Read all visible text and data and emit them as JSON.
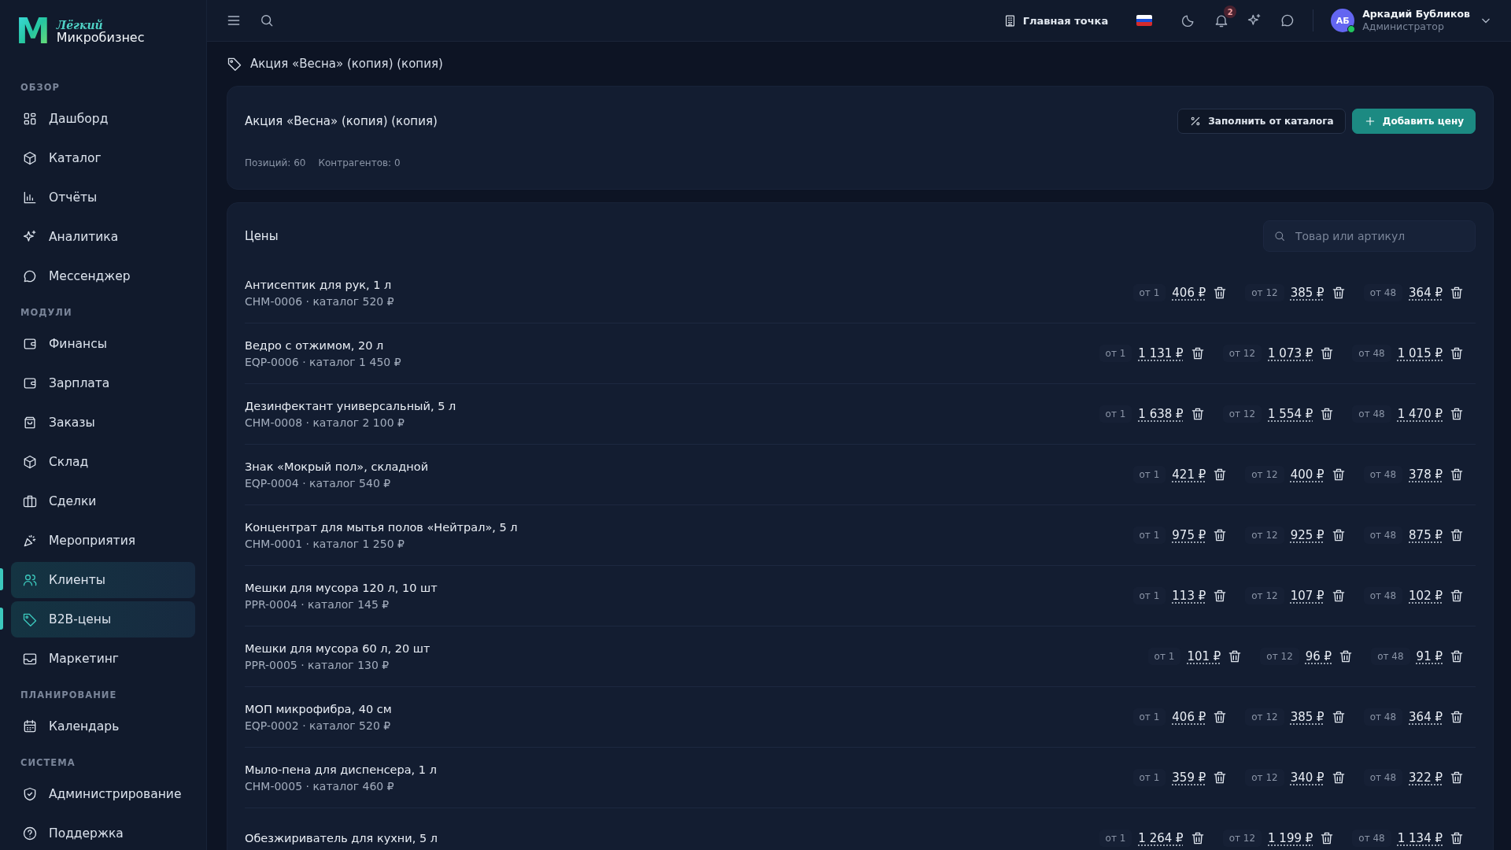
{
  "logo": {
    "mark": "M",
    "tagline": "Лёгкий",
    "name": "Микробизнес"
  },
  "sidebar": {
    "sections": [
      {
        "title": "ОБЗОР",
        "items": [
          {
            "label": "Дашборд",
            "selected": false
          },
          {
            "label": "Каталог",
            "selected": false
          },
          {
            "label": "Отчёты",
            "selected": false
          },
          {
            "label": "Аналитика",
            "selected": false
          },
          {
            "label": "Мессенджер",
            "selected": false
          }
        ]
      },
      {
        "title": "МОДУЛИ",
        "items": [
          {
            "label": "Финансы",
            "selected": false
          },
          {
            "label": "Зарплата",
            "selected": false
          },
          {
            "label": "Заказы",
            "selected": false
          },
          {
            "label": "Склад",
            "selected": false
          },
          {
            "label": "Сделки",
            "selected": false
          },
          {
            "label": "Мероприятия",
            "selected": false
          },
          {
            "label": "Клиенты",
            "selected": true
          },
          {
            "label": "B2B-цены",
            "selected": true
          },
          {
            "label": "Маркетинг",
            "selected": false
          }
        ]
      },
      {
        "title": "ПЛАНИРОВАНИЕ",
        "items": [
          {
            "label": "Календарь",
            "selected": false
          }
        ]
      },
      {
        "title": "СИСТЕМА",
        "items": [
          {
            "label": "Администрирование",
            "selected": false
          },
          {
            "label": "Поддержка",
            "selected": false
          }
        ]
      }
    ]
  },
  "topbar": {
    "location": "Главная точка",
    "notifications": "2",
    "user": {
      "initials": "АБ",
      "name": "Аркадий Бубликов",
      "role": "Администратор",
      "online": true
    }
  },
  "breadcrumb": "Акция «Весна» (копия) (копия)",
  "header": {
    "title": "Акция «Весна» (копия) (копия)",
    "stats": [
      "Позиций: 60",
      "Контрагентов: 0"
    ],
    "buttons": [
      {
        "kind": "secondary",
        "label": "Заполнить от каталога"
      },
      {
        "kind": "primary",
        "label": "Добавить цену"
      }
    ]
  },
  "prices": {
    "title": "Цены",
    "search": {
      "placeholder": "Товар или артикул"
    },
    "rows": [
      {
        "name": "Антисептик для рук, 1 л",
        "sub": "CHM-0006 · каталог 520 ₽",
        "tiers": [
          {
            "label": "от 1",
            "price": "406 ₽"
          },
          {
            "label": "от 12",
            "price": "385 ₽"
          },
          {
            "label": "от 48",
            "price": "364 ₽"
          }
        ]
      },
      {
        "name": "Ведро с отжимом, 20 л",
        "sub": "EQP-0006 · каталог 1 450 ₽",
        "tiers": [
          {
            "label": "от 1",
            "price": "1 131 ₽"
          },
          {
            "label": "от 12",
            "price": "1 073 ₽"
          },
          {
            "label": "от 48",
            "price": "1 015 ₽"
          }
        ]
      },
      {
        "name": "Дезинфектант универсальный, 5 л",
        "sub": "CHM-0008 · каталог 2 100 ₽",
        "tiers": [
          {
            "label": "от 1",
            "price": "1 638 ₽"
          },
          {
            "label": "от 12",
            "price": "1 554 ₽"
          },
          {
            "label": "от 48",
            "price": "1 470 ₽"
          }
        ]
      },
      {
        "name": "Знак «Мокрый пол», складной",
        "sub": "EQP-0004 · каталог 540 ₽",
        "tiers": [
          {
            "label": "от 1",
            "price": "421 ₽"
          },
          {
            "label": "от 12",
            "price": "400 ₽"
          },
          {
            "label": "от 48",
            "price": "378 ₽"
          }
        ]
      },
      {
        "name": "Концентрат для мытья полов «Нейтрал», 5 л",
        "sub": "CHM-0001 · каталог 1 250 ₽",
        "tiers": [
          {
            "label": "от 1",
            "price": "975 ₽"
          },
          {
            "label": "от 12",
            "price": "925 ₽"
          },
          {
            "label": "от 48",
            "price": "875 ₽"
          }
        ]
      },
      {
        "name": "Мешки для мусора 120 л, 10 шт",
        "sub": "PPR-0004 · каталог 145 ₽",
        "tiers": [
          {
            "label": "от 1",
            "price": "113 ₽"
          },
          {
            "label": "от 12",
            "price": "107 ₽"
          },
          {
            "label": "от 48",
            "price": "102 ₽"
          }
        ]
      },
      {
        "name": "Мешки для мусора 60 л, 20 шт",
        "sub": "PPR-0005 · каталог 130 ₽",
        "tiers": [
          {
            "label": "от 1",
            "price": "101 ₽"
          },
          {
            "label": "от 12",
            "price": "96 ₽"
          },
          {
            "label": "от 48",
            "price": "91 ₽"
          }
        ]
      },
      {
        "name": "МОП микрофибра, 40 см",
        "sub": "EQP-0002 · каталог 520 ₽",
        "tiers": [
          {
            "label": "от 1",
            "price": "406 ₽"
          },
          {
            "label": "от 12",
            "price": "385 ₽"
          },
          {
            "label": "от 48",
            "price": "364 ₽"
          }
        ]
      },
      {
        "name": "Мыло-пена для диспенсера, 1 л",
        "sub": "CHM-0005 · каталог 460 ₽",
        "tiers": [
          {
            "label": "от 1",
            "price": "359 ₽"
          },
          {
            "label": "от 12",
            "price": "340 ₽"
          },
          {
            "label": "от 48",
            "price": "322 ₽"
          }
        ]
      },
      {
        "name": "Обезжириватель для кухни, 5 л",
        "tiers": [
          {
            "label": "от 1",
            "price": "1 264 ₽"
          },
          {
            "label": "от 12",
            "price": "1 199 ₽"
          },
          {
            "label": "от 48",
            "price": "1 134 ₽"
          }
        ]
      }
    ]
  }
}
